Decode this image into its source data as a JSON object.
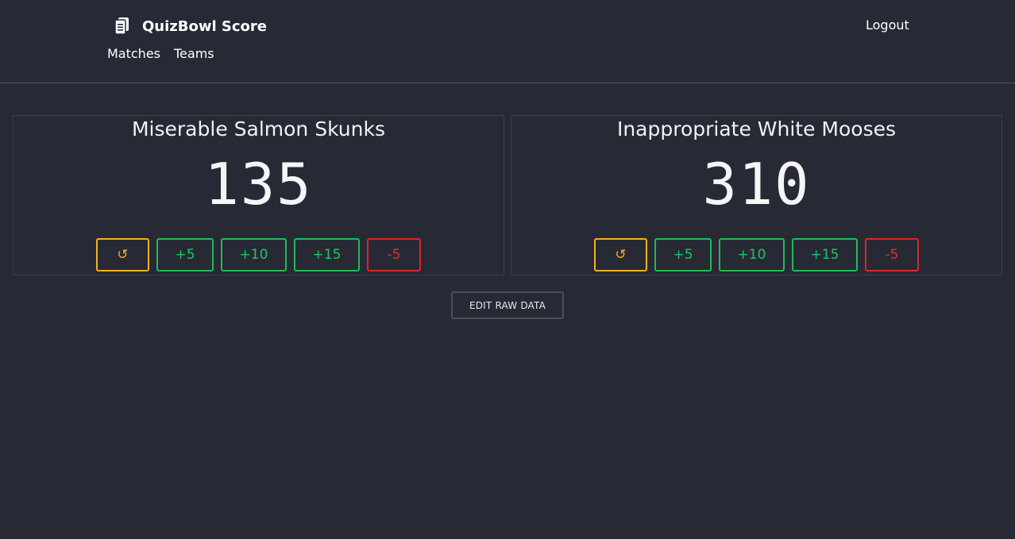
{
  "header": {
    "brand_name": "QuizBowl Score",
    "brand_icon": "clipboard-icon",
    "logout_label": "Logout",
    "nav": [
      {
        "label": "Matches"
      },
      {
        "label": "Teams"
      }
    ]
  },
  "teams": [
    {
      "name": "Miserable Salmon Skunks",
      "score": "135",
      "buttons": {
        "undo": "↺",
        "plus5": "+5",
        "plus10": "+10",
        "plus15": "+15",
        "minus5": "-5"
      }
    },
    {
      "name": "Inappropriate White Mooses",
      "score": "310",
      "buttons": {
        "undo": "↺",
        "plus5": "+5",
        "plus10": "+10",
        "plus15": "+15",
        "minus5": "-5"
      }
    }
  ],
  "actions": {
    "edit_raw_label": "EDIT RAW DATA"
  },
  "colors": {
    "background": "#272935",
    "undo": "#f0b21c",
    "positive": "#22c55e",
    "negative": "#e03030"
  }
}
